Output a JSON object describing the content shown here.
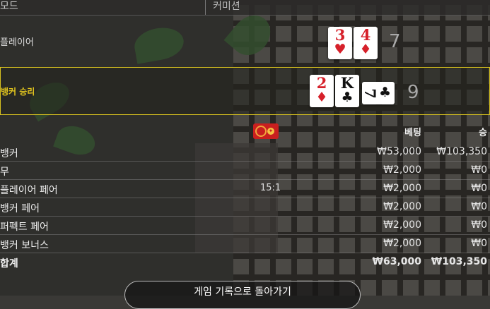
{
  "header": {
    "mode_label": "모드",
    "commission_label": "커미션"
  },
  "player": {
    "label": "플레이어",
    "cards": [
      {
        "rank": "3",
        "suit": "♥",
        "color": "red"
      },
      {
        "rank": "4",
        "suit": "♦",
        "color": "red"
      }
    ],
    "score": "7"
  },
  "banker": {
    "label": "뱅커 승리",
    "cards": [
      {
        "rank": "2",
        "suit": "♦",
        "color": "red"
      },
      {
        "rank": "K",
        "suit": "♣",
        "color": "black"
      },
      {
        "rank": "7",
        "suit": "♣",
        "color": "black"
      }
    ],
    "score": "9",
    "highlight_color": "#d8c21f"
  },
  "table": {
    "bet_header": "베팅",
    "win_header": "승",
    "chip_icon": "red-envelope-chip-icon",
    "rows": [
      {
        "name": "뱅커",
        "payout": "",
        "bet": "₩53,000",
        "win": "₩103,350"
      },
      {
        "name": "무",
        "payout": "",
        "bet": "₩2,000",
        "win": "₩0"
      },
      {
        "name": "플레이어 페어",
        "payout": "15:1",
        "bet": "₩2,000",
        "win": "₩0"
      },
      {
        "name": "뱅커 페어",
        "payout": "",
        "bet": "₩2,000",
        "win": "₩0"
      },
      {
        "name": "퍼펙트 페어",
        "payout": "",
        "bet": "₩2,000",
        "win": "₩0"
      },
      {
        "name": "뱅커 보너스",
        "payout": "",
        "bet": "₩2,000",
        "win": "₩0"
      }
    ],
    "total": {
      "name": "합계",
      "bet": "₩63,000",
      "win": "₩103,350"
    }
  },
  "bottom": {
    "left_text": "",
    "button_label": "게임 기록으로 돌아가기"
  }
}
